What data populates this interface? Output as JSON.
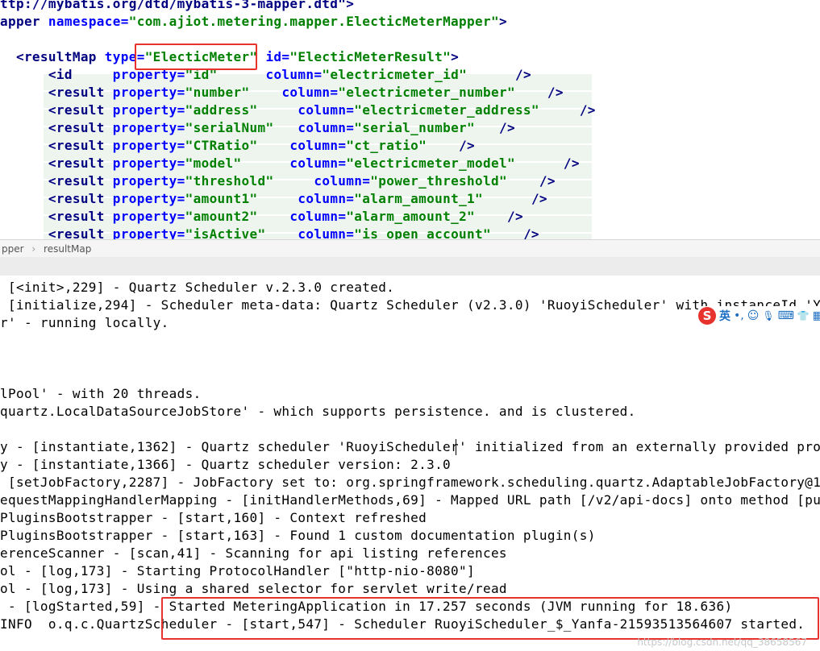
{
  "editor": {
    "lines": [
      {
        "parts": [
          {
            "c": "tag",
            "t": "ttp://mybatis.org/dtd/mybatis-3-mapper.dtd\">"
          }
        ]
      },
      {
        "parts": [
          {
            "c": "tag",
            "t": "apper "
          },
          {
            "c": "attr",
            "t": "namespace="
          },
          {
            "c": "val",
            "t": "\"com.ajiot.metering.mapper.ElecticMeterMapper\""
          },
          {
            "c": "tag",
            "t": ">"
          }
        ]
      },
      {
        "parts": []
      },
      {
        "parts": [
          {
            "c": "tag",
            "t": "  <resultMap "
          },
          {
            "c": "attr",
            "t": "type="
          },
          {
            "c": "val",
            "t": "\"ElecticMeter\""
          },
          {
            "c": "plain",
            "t": " "
          },
          {
            "c": "attr",
            "t": "id="
          },
          {
            "c": "val",
            "t": "\"ElecticMeterResult\""
          },
          {
            "c": "tag",
            "t": ">"
          }
        ]
      },
      {
        "parts": [
          {
            "c": "tag",
            "t": "      <id     "
          },
          {
            "c": "attr",
            "t": "property="
          },
          {
            "c": "val",
            "t": "\"id\""
          },
          {
            "c": "plain",
            "t": "      "
          },
          {
            "c": "attr",
            "t": "column="
          },
          {
            "c": "val",
            "t": "\"electricmeter_id\""
          },
          {
            "c": "plain",
            "t": "      "
          },
          {
            "c": "tag",
            "t": "/>"
          }
        ]
      },
      {
        "parts": [
          {
            "c": "tag",
            "t": "      <result "
          },
          {
            "c": "attr",
            "t": "property="
          },
          {
            "c": "val",
            "t": "\"number\""
          },
          {
            "c": "plain",
            "t": "    "
          },
          {
            "c": "attr",
            "t": "column="
          },
          {
            "c": "val",
            "t": "\"electricmeter_number\""
          },
          {
            "c": "plain",
            "t": "    "
          },
          {
            "c": "tag",
            "t": "/>"
          }
        ]
      },
      {
        "parts": [
          {
            "c": "tag",
            "t": "      <result "
          },
          {
            "c": "attr",
            "t": "property="
          },
          {
            "c": "val",
            "t": "\"address\""
          },
          {
            "c": "plain",
            "t": "     "
          },
          {
            "c": "attr",
            "t": "column="
          },
          {
            "c": "val",
            "t": "\"electricmeter_address\""
          },
          {
            "c": "plain",
            "t": "     "
          },
          {
            "c": "tag",
            "t": "/>"
          }
        ]
      },
      {
        "parts": [
          {
            "c": "tag",
            "t": "      <result "
          },
          {
            "c": "attr",
            "t": "property="
          },
          {
            "c": "val",
            "t": "\"serialNum\""
          },
          {
            "c": "plain",
            "t": "   "
          },
          {
            "c": "attr",
            "t": "column="
          },
          {
            "c": "val",
            "t": "\"serial_number\""
          },
          {
            "c": "plain",
            "t": "   "
          },
          {
            "c": "tag",
            "t": "/>"
          }
        ]
      },
      {
        "parts": [
          {
            "c": "tag",
            "t": "      <result "
          },
          {
            "c": "attr",
            "t": "property="
          },
          {
            "c": "val",
            "t": "\"CTRatio\""
          },
          {
            "c": "plain",
            "t": "    "
          },
          {
            "c": "attr",
            "t": "column="
          },
          {
            "c": "val",
            "t": "\"ct_ratio\""
          },
          {
            "c": "plain",
            "t": "    "
          },
          {
            "c": "tag",
            "t": "/>"
          }
        ]
      },
      {
        "parts": [
          {
            "c": "tag",
            "t": "      <result "
          },
          {
            "c": "attr",
            "t": "property="
          },
          {
            "c": "val",
            "t": "\"model\""
          },
          {
            "c": "plain",
            "t": "      "
          },
          {
            "c": "attr",
            "t": "column="
          },
          {
            "c": "val",
            "t": "\"electricmeter_model\""
          },
          {
            "c": "plain",
            "t": "      "
          },
          {
            "c": "tag",
            "t": "/>"
          }
        ]
      },
      {
        "parts": [
          {
            "c": "tag",
            "t": "      <result "
          },
          {
            "c": "attr",
            "t": "property="
          },
          {
            "c": "val",
            "t": "\"threshold\""
          },
          {
            "c": "plain",
            "t": "     "
          },
          {
            "c": "attr",
            "t": "column="
          },
          {
            "c": "val",
            "t": "\"power_threshold\""
          },
          {
            "c": "plain",
            "t": "    "
          },
          {
            "c": "tag",
            "t": "/>"
          }
        ]
      },
      {
        "parts": [
          {
            "c": "tag",
            "t": "      <result "
          },
          {
            "c": "attr",
            "t": "property="
          },
          {
            "c": "val",
            "t": "\"amount1\""
          },
          {
            "c": "plain",
            "t": "     "
          },
          {
            "c": "attr",
            "t": "column="
          },
          {
            "c": "val",
            "t": "\"alarm_amount_1\""
          },
          {
            "c": "plain",
            "t": "      "
          },
          {
            "c": "tag",
            "t": "/>"
          }
        ]
      },
      {
        "parts": [
          {
            "c": "tag",
            "t": "      <result "
          },
          {
            "c": "attr",
            "t": "property="
          },
          {
            "c": "val",
            "t": "\"amount2\""
          },
          {
            "c": "plain",
            "t": "    "
          },
          {
            "c": "attr",
            "t": "column="
          },
          {
            "c": "val",
            "t": "\"alarm_amount_2\""
          },
          {
            "c": "plain",
            "t": "    "
          },
          {
            "c": "tag",
            "t": "/>"
          }
        ]
      },
      {
        "parts": [
          {
            "c": "tag",
            "t": "      <result "
          },
          {
            "c": "attr",
            "t": "property="
          },
          {
            "c": "val",
            "t": "\"isActive\""
          },
          {
            "c": "plain",
            "t": "    "
          },
          {
            "c": "attr",
            "t": "column="
          },
          {
            "c": "val",
            "t": "\"is_open_account\""
          },
          {
            "c": "plain",
            "t": "    "
          },
          {
            "c": "tag",
            "t": "/>"
          }
        ]
      }
    ]
  },
  "breadcrumb": {
    "items": [
      "pper",
      "resultMap"
    ],
    "separator": "›"
  },
  "console": {
    "lines": [
      " [<init>,229] - Quartz Scheduler v.2.3.0 created.",
      " [initialize,294] - Scheduler meta-data: Quartz Scheduler (v2.3.0) 'RuoyiScheduler' with instanceId 'Ya",
      "r' - running locally.",
      "",
      "",
      "",
      "lPool' - with 20 threads.",
      "quartz.LocalDataSourceJobStore' - which supports persistence. and is clustered.",
      "",
      "y - [instantiate,1362] - Quartz scheduler 'RuoyiScheduler' initialized from an externally provided pro",
      "y - [instantiate,1366] - Quartz scheduler version: 2.3.0",
      " [setJobFactory,2287] - JobFactory set to: org.springframework.scheduling.quartz.AdaptableJobFactory@14",
      "equestMappingHandlerMapping - [initHandlerMethods,69] - Mapped URL path [/v2/api-docs] onto method [pu",
      "PluginsBootstrapper - [start,160] - Context refreshed",
      "PluginsBootstrapper - [start,163] - Found 1 custom documentation plugin(s)",
      "erenceScanner - [scan,41] - Scanning for api listing references",
      "ol - [log,173] - Starting ProtocolHandler [\"http-nio-8080\"]",
      "ol - [log,173] - Using a shared selector for servlet write/read",
      " - [logStarted,59] - Started MeteringApplication in 17.257 seconds (JVM running for 18.636)",
      "INFO  o.q.c.QuartzScheduler - [start,547] - Scheduler RuoyiScheduler_$_Yanfa-21593513564607 started."
    ]
  },
  "ime": {
    "logo": "S",
    "lang": "英",
    "items": [
      "•,",
      "☺",
      "🎙",
      "⌨",
      "👕",
      "▦"
    ]
  },
  "watermark": "https://blog.csdn.net/qq_38658567",
  "colors": {
    "highlight_box": "#e8322d",
    "tag": "#000080",
    "attribute": "#0000ff",
    "value": "#008000"
  }
}
